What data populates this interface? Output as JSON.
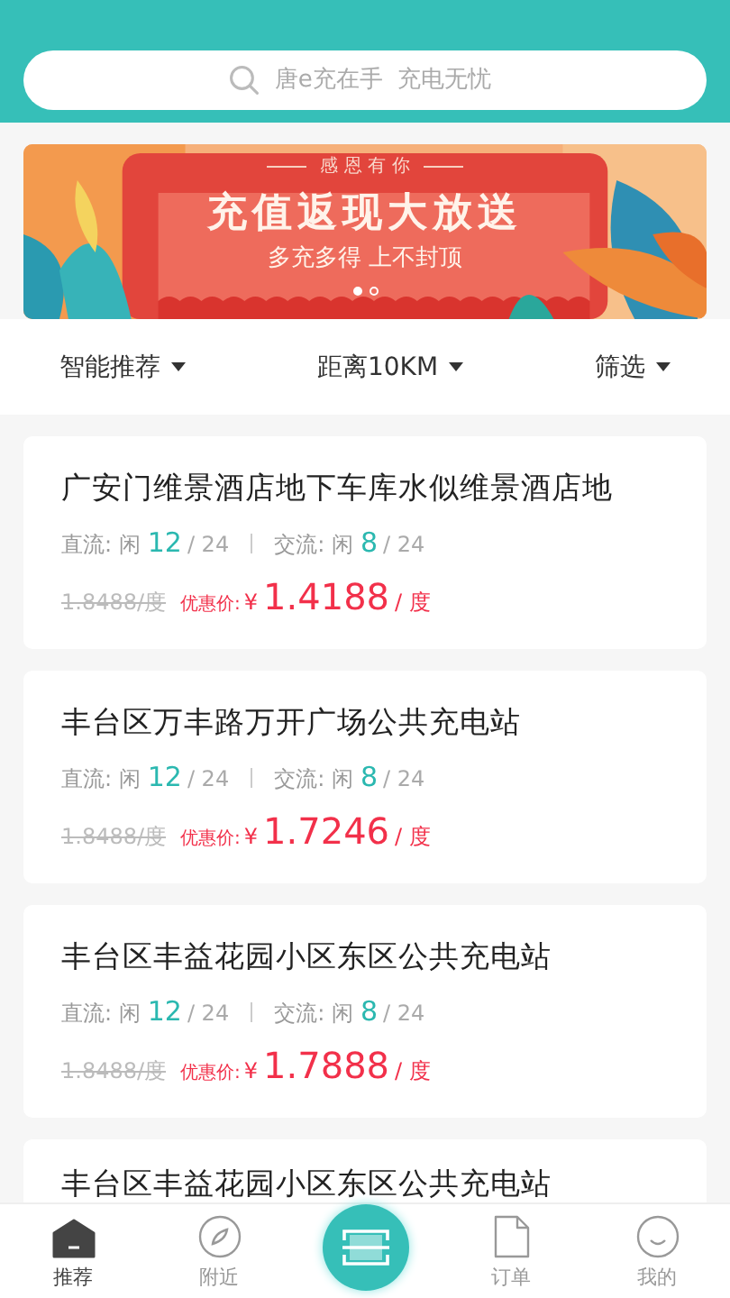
{
  "search": {
    "placeholder": "唐e充在手  充电无忧"
  },
  "banner": {
    "kicker": "感 恩 有 你",
    "headline": "充值返现大放送",
    "subline": "多充多得 上不封顶",
    "dots": [
      {
        "selected": true
      },
      {
        "selected": false
      }
    ]
  },
  "filters": [
    {
      "label": "智能推荐"
    },
    {
      "label": "距离10KM"
    },
    {
      "label": "筛选"
    }
  ],
  "stations": [
    {
      "name": "广安门维景酒店地下车库水似维景酒店地",
      "dc_label": "直流: 闲",
      "dc_free": "12",
      "dc_total": "/ 24",
      "ac_label": "交流: 闲",
      "ac_free": "8",
      "ac_total": "/ 24",
      "old_price": "1.8488/度",
      "discount_label": "优惠价:",
      "currency": "¥",
      "price": "1.4188",
      "unit": "/ 度"
    },
    {
      "name": "丰台区万丰路万开广场公共充电站",
      "dc_label": "直流: 闲",
      "dc_free": "12",
      "dc_total": "/ 24",
      "ac_label": "交流: 闲",
      "ac_free": "8",
      "ac_total": "/ 24",
      "old_price": "1.8488/度",
      "discount_label": "优惠价:",
      "currency": "¥",
      "price": "1.7246",
      "unit": "/ 度"
    },
    {
      "name": "丰台区丰益花园小区东区公共充电站",
      "dc_label": "直流: 闲",
      "dc_free": "12",
      "dc_total": "/ 24",
      "ac_label": "交流: 闲",
      "ac_free": "8",
      "ac_total": "/ 24",
      "old_price": "1.8488/度",
      "discount_label": "优惠价:",
      "currency": "¥",
      "price": "1.7888",
      "unit": "/ 度"
    },
    {
      "name": "丰台区丰益花园小区东区公共充电站"
    }
  ],
  "tabbar": [
    {
      "kind": "home",
      "label": "推荐",
      "selected": true
    },
    {
      "kind": "compass",
      "label": "附近",
      "selected": false
    },
    {
      "kind": "scan",
      "selected": false
    },
    {
      "kind": "doc",
      "label": "订单",
      "selected": false
    },
    {
      "kind": "smile",
      "label": "我的",
      "selected": false
    }
  ]
}
